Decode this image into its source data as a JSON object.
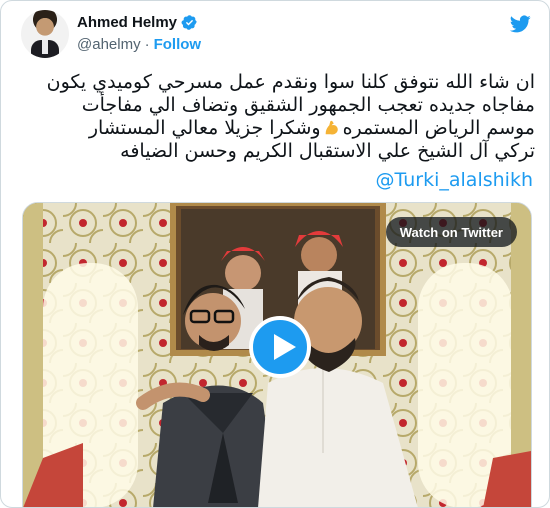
{
  "author": {
    "name": "Ahmed Helmy",
    "handle": "@ahelmy",
    "separator": "·",
    "follow_label": "Follow",
    "verified": true
  },
  "icons": {
    "platform": "twitter-bird-icon",
    "verified": "verified-badge-icon",
    "emoji": "flexed-biceps-icon",
    "play": "play-icon"
  },
  "tweet": {
    "lines": [
      "ان شاء الله نتوفق كلنا سوا ونقدم عمل مسرحي كوميدي يكون",
      "مفاجاه جديده تعجب الجمهور الشقيق وتضاف الي مفاجأت",
      "موسم الرياض المستمره",
      "وشكرا جزيلا معالي المستشار",
      "تركي آل الشيخ علي الاستقبال الكريم وحسن الضيافه"
    ],
    "mention": "@Turki_alalshikh"
  },
  "media": {
    "watch_label": "Watch on Twitter"
  },
  "colors": {
    "accent": "#1d9bf0",
    "text": "#0f1419",
    "secondary": "#536471",
    "border": "#cfd9de"
  }
}
